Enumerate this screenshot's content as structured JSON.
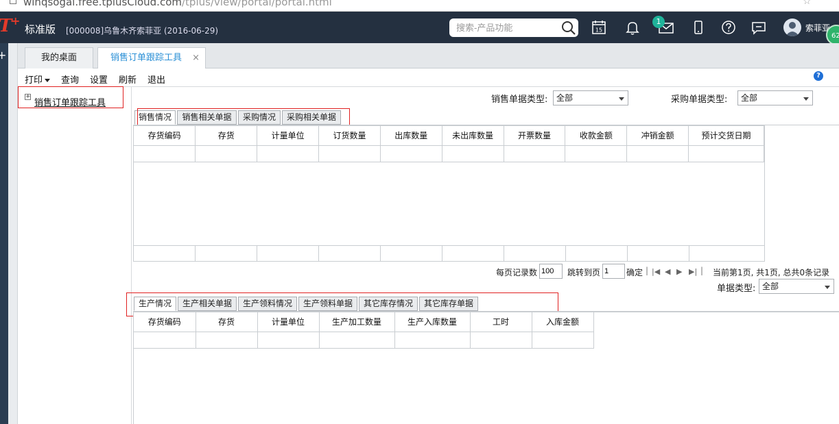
{
  "browser": {
    "url_visible": "winqsogal.free.tplusCloud.com",
    "url_dim": "/tplus/view/portal/portal.html"
  },
  "header": {
    "edition": "标准版",
    "company": "[000008]乌鲁木齐索菲亚   (2016-06-29)",
    "search_placeholder": "搜索-产品功能",
    "calendar_day": "15",
    "mail_badge": "1",
    "username": "索菲亚",
    "float_count": "62"
  },
  "page_tabs": [
    {
      "label": "我的桌面"
    },
    {
      "label": "销售订单跟踪工具",
      "close": "×"
    }
  ],
  "toolbar": {
    "print": "打印",
    "query": "查询",
    "settings": "设置",
    "refresh": "刷新",
    "exit": "退出",
    "help": "?"
  },
  "tree": {
    "toggle": "+",
    "root": "销售订单跟踪工具"
  },
  "filters": {
    "sales_type_label": "销售单据类型:",
    "sales_type_value": "全部",
    "purchase_type_label": "采购单据类型:",
    "purchase_type_value": "全部"
  },
  "upper_tabs": [
    "销售情况",
    "销售相关单据",
    "采购情况",
    "采购相关单据"
  ],
  "upper_grid": {
    "columns": [
      "存货编码",
      "存货",
      "计量单位",
      "订货数量",
      "出库数量",
      "未出库数量",
      "开票数量",
      "收款金额",
      "冲销金额",
      "预计交货日期"
    ]
  },
  "pager": {
    "per_page_label": "每页记录数",
    "per_page_value": "100",
    "goto_label": "跳转到页",
    "goto_value": "1",
    "confirm": "确定",
    "status": "当前第1页, 共1页, 总共0条记录",
    "doc_type_label": "单据类型:",
    "doc_type_value": "全部"
  },
  "lower_tabs": [
    "生产情况",
    "生产相关单据",
    "生产领料情况",
    "生产领料单据",
    "其它库存情况",
    "其它库存单据"
  ],
  "lower_grid": {
    "columns": [
      "存货编码",
      "存货",
      "计量单位",
      "生产加工数量",
      "生产入库数量",
      "工时",
      "入库金额"
    ]
  },
  "colors": {
    "header_bg": "#243040",
    "accent": "#2a8fd6",
    "highlight_box": "#e02020",
    "badge": "#1fb39a"
  }
}
